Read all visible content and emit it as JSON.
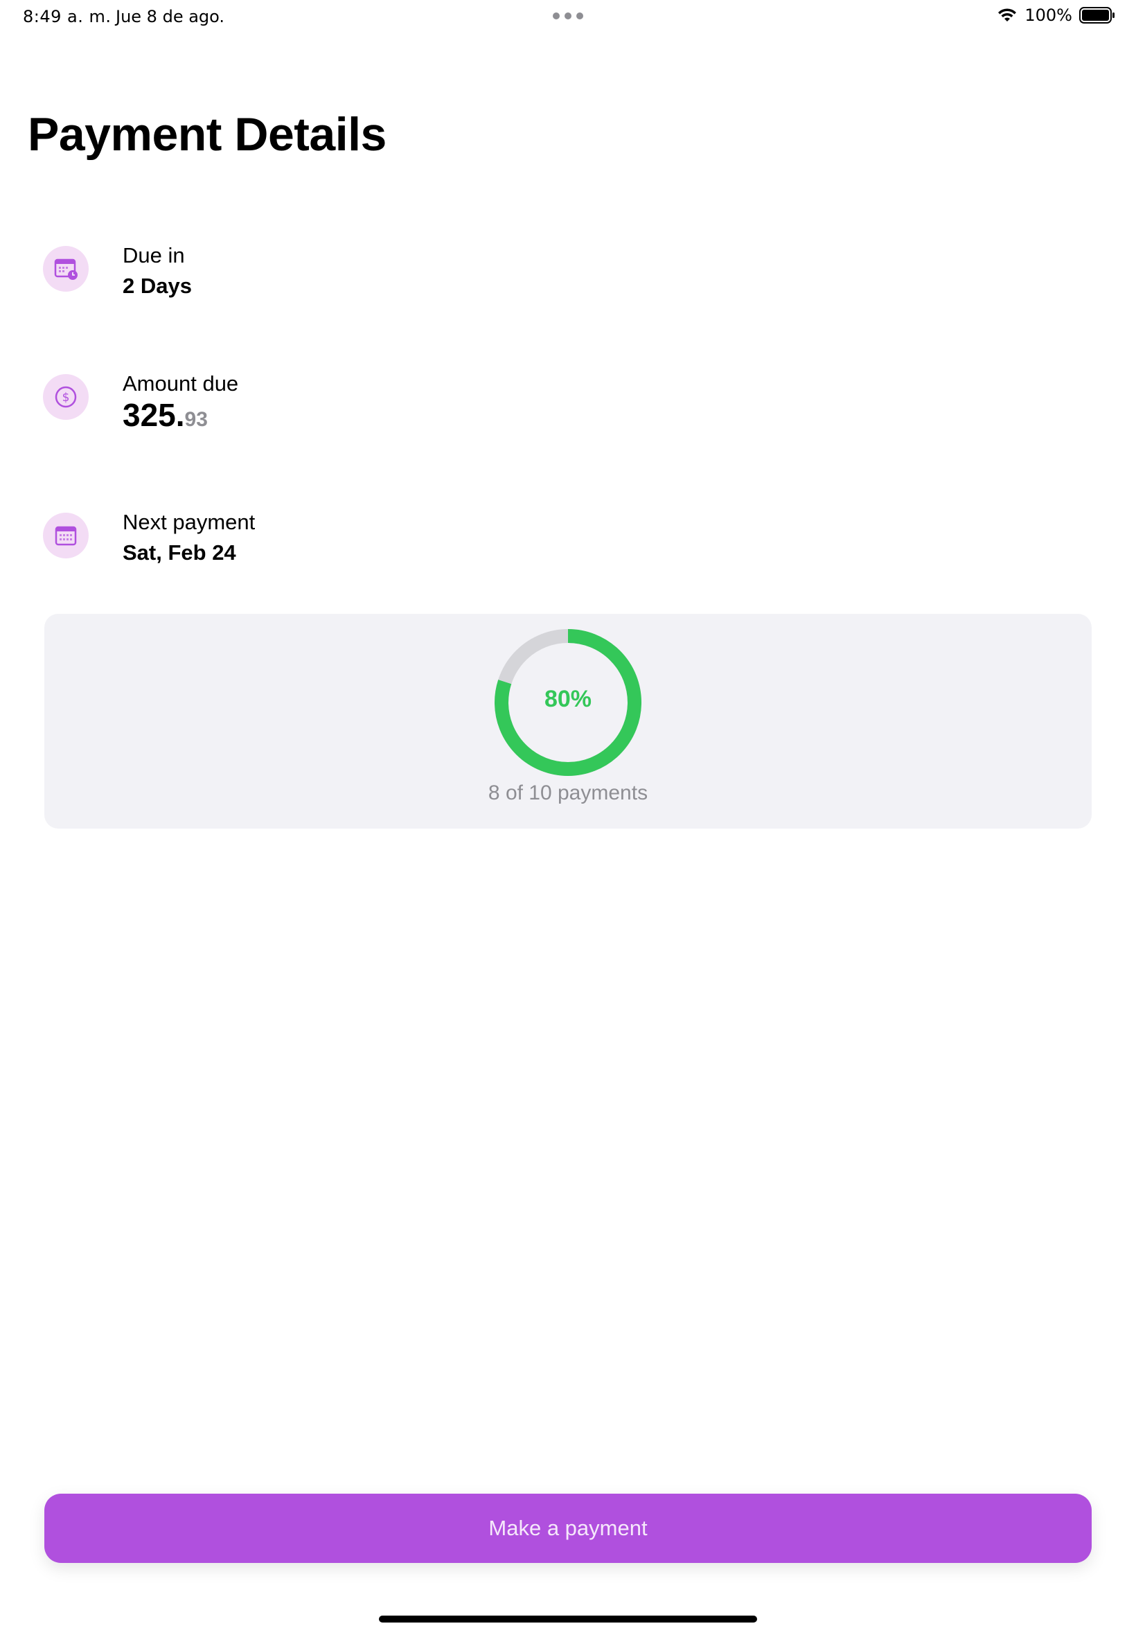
{
  "status_bar": {
    "time": "8:49 a. m.",
    "date": "Jue 8 de ago.",
    "battery": "100%",
    "icons": [
      "wifi-icon",
      "battery-icon",
      "more-dots-icon"
    ]
  },
  "title": "Payment Details",
  "details": {
    "due": {
      "label": "Due in",
      "value": "2 Days",
      "icon": "calendar-clock-icon"
    },
    "amount": {
      "label": "Amount due",
      "whole": "325.",
      "cents": "93",
      "icon": "dollar-circle-icon"
    },
    "next": {
      "label": "Next payment",
      "value": "Sat, Feb 24",
      "icon": "calendar-icon"
    }
  },
  "progress": {
    "percent_label": "80%",
    "fraction": 0.8,
    "caption": "8 of 10 payments"
  },
  "button": {
    "label": "Make a payment"
  },
  "colors": {
    "accent": "#b050de",
    "icon_bg": "#f3dcf5",
    "progress_green": "#34c759",
    "progress_track": "#d5d5d9",
    "card_bg": "#f2f2f6",
    "secondary_text": "#8e8e93"
  }
}
